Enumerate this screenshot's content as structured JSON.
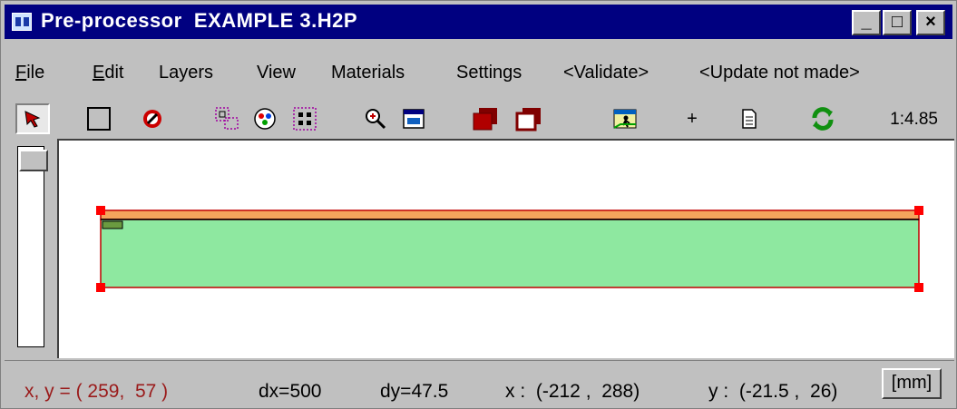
{
  "window": {
    "title": "Pre-processor  EXAMPLE 3.H2P"
  },
  "window_controls": {
    "minimize": "_",
    "maximize": "□",
    "close": "×"
  },
  "menu": {
    "items": [
      {
        "label": "File",
        "mnemonic": "F"
      },
      {
        "label": "Edit",
        "mnemonic": "E"
      },
      {
        "label": "Layers"
      },
      {
        "label": "View"
      },
      {
        "label": "Materials"
      },
      {
        "label": "Settings"
      },
      {
        "label": "<Validate>"
      },
      {
        "label": "<Update not made>"
      }
    ]
  },
  "toolbar": {
    "tools": [
      "select-arrow",
      "rectangle",
      "no-entry",
      "move-frame",
      "palette",
      "points-grid",
      "zoom-in",
      "zoom-fit",
      "solid-square",
      "outline-square",
      "run",
      "plus",
      "document",
      "refresh"
    ],
    "scale": "1:4.85"
  },
  "colors": {
    "titlebar": "#000080",
    "layer_main": "#8ee8a0",
    "layer_top": "#f4a45c",
    "handle": "#ff0000",
    "status_coords": "#9a1a1a"
  },
  "status": {
    "xy": "x, y = ( 259,  57 )",
    "dx": "dx=500",
    "dy": "dy=47.5",
    "x_range": "x :  (-212 ,  288)",
    "y_range": "y :  (-21.5 ,  26)",
    "unit": "[mm]"
  }
}
